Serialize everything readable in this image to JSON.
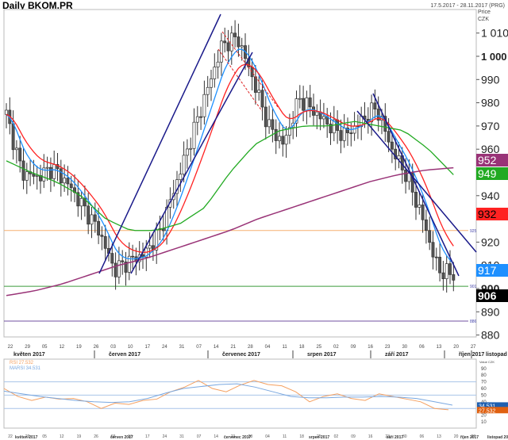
{
  "header": {
    "title": "Daily BKOM.PR",
    "range": "17.5.2017 - 28.11.2017 (PRG)",
    "price_label": "Price",
    "currency": "CZK"
  },
  "chart_data": [
    {
      "type": "candlestick",
      "title": "Daily BKOM.PR",
      "ylabel": "Price CZK",
      "ylim": [
        876,
        1020
      ],
      "y_ticks": [
        "1 010",
        "1 000",
        "990",
        "980",
        "970",
        "960",
        "940",
        "920",
        "910",
        "900",
        "890",
        "880"
      ],
      "y_tick_values": [
        1010,
        1000,
        990,
        980,
        970,
        960,
        940,
        920,
        910,
        900,
        890,
        880
      ],
      "x_ticks": [
        "22",
        "29",
        "05",
        "12",
        "19",
        "26",
        "03",
        "10",
        "17",
        "24",
        "31",
        "07",
        "14",
        "21",
        "28",
        "04",
        "11",
        "18",
        "25",
        "02",
        "09",
        "16",
        "23",
        "30",
        "06",
        "13",
        "20",
        "27"
      ],
      "months": [
        "květen 2017",
        "červen 2017",
        "červenec 2017",
        "srpen 2017",
        "září 2017",
        "říjen 2017",
        "listopad 2017"
      ],
      "weekly_closes": [
        975,
        950,
        948,
        952,
        945,
        935,
        925,
        908,
        912,
        915,
        925,
        945,
        965,
        985,
        1005,
        1008,
        990,
        970,
        962,
        982,
        976,
        970,
        966,
        972,
        978,
        960,
        948,
        930,
        908,
        906
      ],
      "purple_ma": [
        897,
        899,
        902,
        906,
        910,
        913,
        917,
        921,
        925,
        930,
        934,
        938,
        942,
        946,
        949,
        951,
        952
      ],
      "green_ma": [
        955,
        950,
        946,
        940,
        930,
        925,
        925,
        928,
        935,
        950,
        962,
        968,
        970,
        970,
        972,
        970,
        968,
        960,
        949
      ],
      "horizontal_levels": [
        {
          "value": 925,
          "label": "925",
          "color": "#f5b070"
        },
        {
          "value": 901,
          "label": "901",
          "color": "#3a9a3a"
        },
        {
          "value": 886,
          "label": "886",
          "color": "#7050a0"
        }
      ],
      "last_values": [
        {
          "label": "952",
          "color": "#993377",
          "value": 952
        },
        {
          "label": "949",
          "color": "#22aa22",
          "value": 949
        },
        {
          "label": "932",
          "color": "#ff2222",
          "value": 932
        },
        {
          "label": "917",
          "color": "#1e90ff",
          "value": 917
        },
        {
          "label": "906",
          "color": "#000000",
          "value": 906
        }
      ]
    },
    {
      "type": "line",
      "title": "RSI",
      "ylabel": "Value CZK",
      "ylim": [
        0,
        100
      ],
      "y_ticks": [
        "90",
        "80",
        "70",
        "60",
        "50",
        "40",
        "30",
        "20",
        "10"
      ],
      "levels": [
        70,
        50,
        30
      ],
      "series": [
        {
          "name": "RSI",
          "label": "RSI 27.532",
          "color": "#f5a060",
          "values": [
            60,
            48,
            42,
            47,
            44,
            45,
            40,
            30,
            38,
            36,
            42,
            44,
            55,
            62,
            72,
            60,
            55,
            65,
            72,
            66,
            64,
            55,
            40,
            48,
            52,
            45,
            42,
            52,
            48,
            44,
            40,
            30,
            28
          ]
        },
        {
          "name": "MARSI",
          "label": "MARSI 34.531",
          "color": "#7aa8e0",
          "values": [
            56,
            52,
            48,
            45,
            42,
            40,
            39,
            40,
            45,
            53,
            60,
            63,
            66,
            67,
            62,
            55,
            48,
            46,
            46,
            47,
            47,
            48,
            47,
            45,
            40,
            35
          ]
        }
      ],
      "last_values": [
        {
          "label": "34.531",
          "color": "#1e5fb0"
        },
        {
          "label": "27.532",
          "color": "#e06010"
        }
      ]
    }
  ]
}
